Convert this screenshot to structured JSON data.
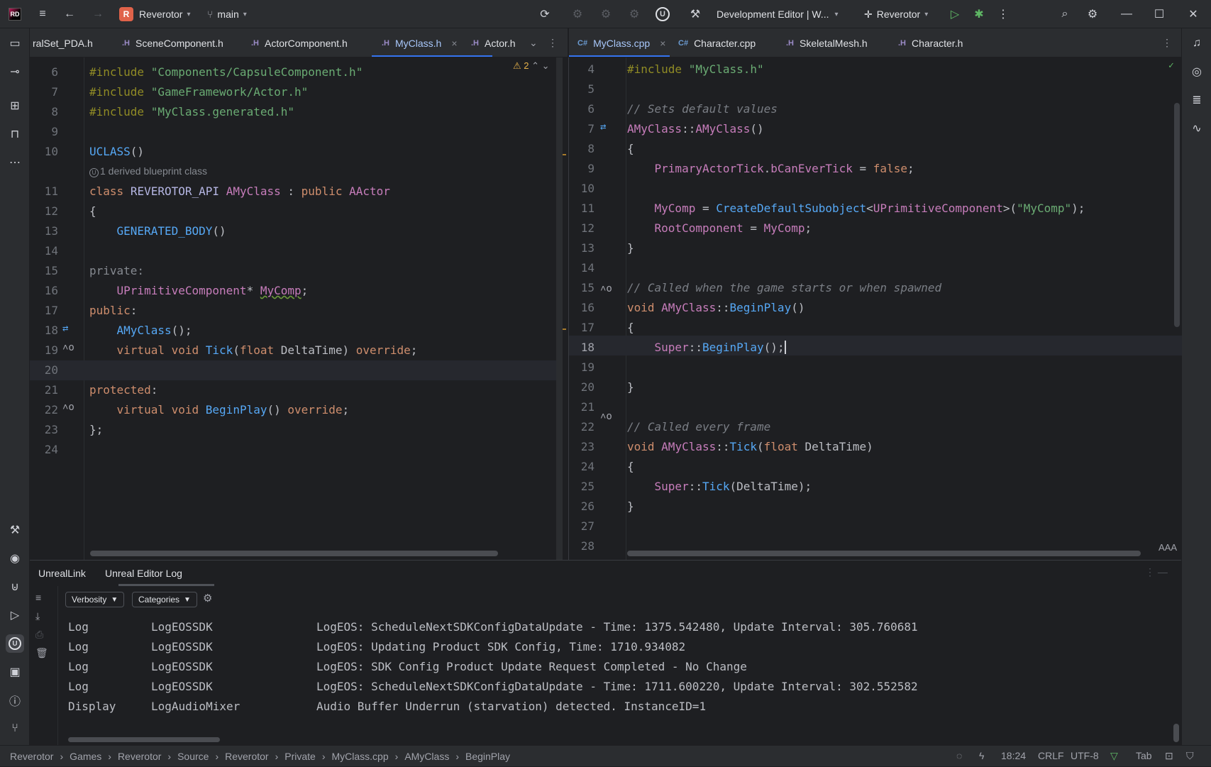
{
  "titlebar": {
    "project_badge": "R",
    "project": "Reverotor",
    "branch": "main",
    "run_config": "Development Editor | W...",
    "target": "Reverotor"
  },
  "left_tabs": [
    {
      "label": "ralSet_PDA.h",
      "icon": "h-file-icon"
    },
    {
      "label": "SceneComponent.h",
      "icon": "h-file-icon"
    },
    {
      "label": "ActorComponent.h",
      "icon": "h-file-icon"
    },
    {
      "label": "MyClass.h",
      "icon": "h-file-icon",
      "active": true
    },
    {
      "label": "Actor.h",
      "icon": "h-file-icon"
    }
  ],
  "right_tabs": [
    {
      "label": "MyClass.cpp",
      "icon": "cpp-file-icon",
      "active": true
    },
    {
      "label": "Character.cpp",
      "icon": "cpp-file-icon"
    },
    {
      "label": "SkeletalMesh.h",
      "icon": "h-file-icon"
    },
    {
      "label": "Character.h",
      "icon": "h-file-icon"
    }
  ],
  "left_editor": {
    "warnings": "2",
    "line_numbers": [
      "6",
      "7",
      "8",
      "9",
      "10",
      "11",
      "12",
      "13",
      "14",
      "15",
      "16",
      "17",
      "18",
      "19",
      "20",
      "21",
      "22",
      "23",
      "24"
    ],
    "inlay_hint": "1 derived blueprint class"
  },
  "right_editor": {
    "line_numbers": [
      "4",
      "5",
      "6",
      "7",
      "8",
      "9",
      "10",
      "11",
      "12",
      "13",
      "14",
      "15",
      "16",
      "17",
      "18",
      "19",
      "20",
      "21",
      "22",
      "23",
      "24",
      "25",
      "26",
      "27",
      "28"
    ],
    "reader_mode": "AAA"
  },
  "bottom_panel": {
    "tabs": [
      "UnrealLink",
      "Unreal Editor Log"
    ],
    "verbosity": "Verbosity",
    "categories": "Categories",
    "log": [
      {
        "level": "Log",
        "category": "LogEOSSDK",
        "message": "LogEOS: ScheduleNextSDKConfigDataUpdate - Time: 1375.542480, Update Interval: 305.760681"
      },
      {
        "level": "Log",
        "category": "LogEOSSDK",
        "message": "LogEOS: Updating Product SDK Config, Time: 1710.934082"
      },
      {
        "level": "Log",
        "category": "LogEOSSDK",
        "message": "LogEOS: SDK Config Product Update Request Completed - No Change"
      },
      {
        "level": "Log",
        "category": "LogEOSSDK",
        "message": "LogEOS: ScheduleNextSDKConfigDataUpdate - Time: 1711.600220, Update Interval: 302.552582"
      },
      {
        "level": "Display",
        "category": "LogAudioMixer",
        "message": "Audio Buffer Underrun (starvation) detected. InstanceID=1"
      }
    ]
  },
  "statusbar": {
    "breadcrumbs": [
      "Reverotor",
      "Games",
      "Reverotor",
      "Source",
      "Reverotor",
      "Private",
      "MyClass.cpp",
      "AMyClass",
      "BeginPlay"
    ],
    "position": "18:24",
    "line_ending": "CRLF",
    "encoding": "UTF-8",
    "indent": "Tab"
  }
}
